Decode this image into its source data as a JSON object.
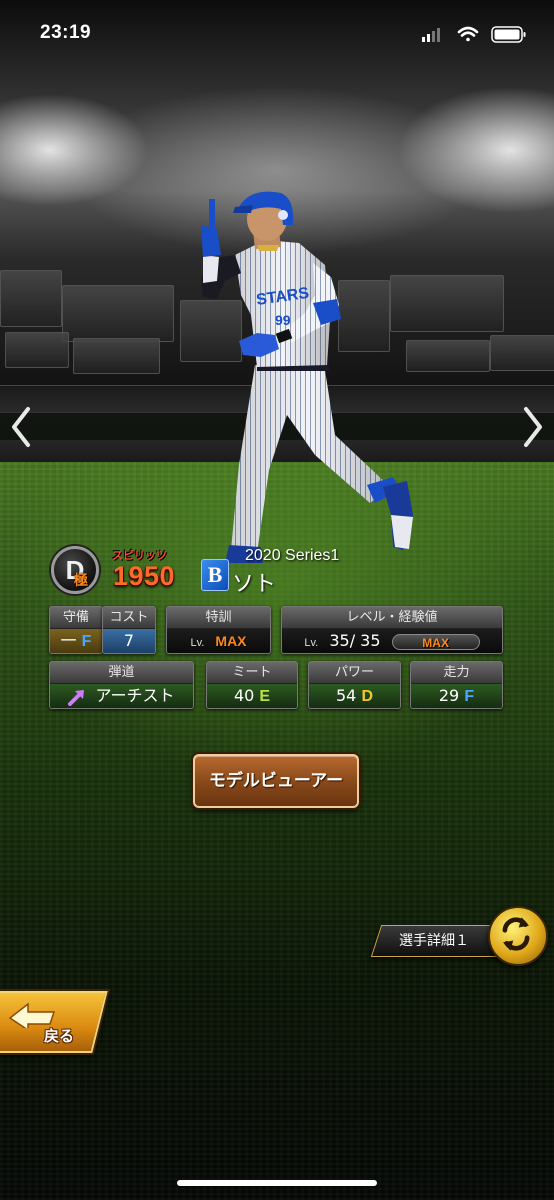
{
  "status_bar": {
    "time": "23:19",
    "icons": [
      "cellular-signal-icon",
      "wifi-icon",
      "battery-icon"
    ]
  },
  "nav": {
    "prev_icon": "chevron-left-icon",
    "next_icon": "chevron-right-icon"
  },
  "player": {
    "rank": "D",
    "rank_sub": "極",
    "spirits_label": "スピリッツ",
    "spirits_value": "1950",
    "team_logo_letter": "B",
    "series": "2020 Series1",
    "name": "ソト",
    "jersey_number": "99"
  },
  "stats_row1": {
    "defense": {
      "header": "守備",
      "position": "一",
      "grade": "F"
    },
    "cost": {
      "header": "コスト",
      "value": "7"
    },
    "special_training": {
      "header": "特訓",
      "lv_prefix": "Lv.",
      "value": "MAX"
    },
    "level_exp": {
      "header": "レベル・経験値",
      "lv_prefix": "Lv.",
      "level": "35/ 35",
      "exp_status": "MAX"
    }
  },
  "stats_row2": {
    "trajectory": {
      "header": "弾道",
      "icon": "trajectory-arrow-icon",
      "value": "アーチスト"
    },
    "meet": {
      "header": "ミート",
      "value": "40",
      "grade": "E"
    },
    "power": {
      "header": "パワー",
      "value": "54",
      "grade": "D"
    },
    "speed": {
      "header": "走力",
      "value": "29",
      "grade": "F"
    }
  },
  "buttons": {
    "model_viewer": "モデルビューアー",
    "player_detail": "選手詳細１",
    "player_detail_icon": "swap-arrows-icon",
    "back": "戻る",
    "back_icon": "back-arrow-icon"
  },
  "colors": {
    "spirits": "#ff6a2a",
    "max": "#ff8a1a",
    "grade_F": "#4aa8ff",
    "grade_E": "#b8e04a",
    "grade_D": "#f0c830",
    "team_blue": "#0b4db4"
  }
}
